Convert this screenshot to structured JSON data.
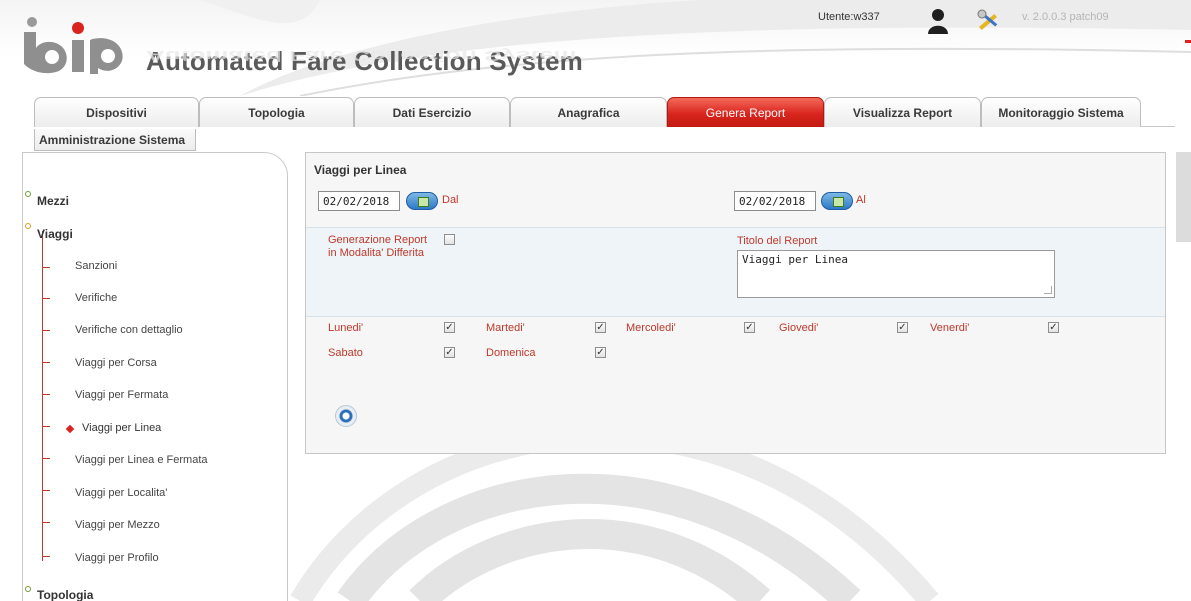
{
  "header": {
    "logo_text": "bip",
    "app_title": "Automated Fare Collection System",
    "user": "Utente:w337",
    "version": "v. 2.0.0.3 patch09",
    "icons": [
      "user-icon",
      "tools-icon"
    ]
  },
  "tabs": [
    {
      "label": "Dispositivi",
      "active": false
    },
    {
      "label": "Topologia",
      "active": false
    },
    {
      "label": "Dati Esercizio",
      "active": false
    },
    {
      "label": "Anagrafica",
      "active": false
    },
    {
      "label": "Genera Report",
      "active": true
    },
    {
      "label": "Visualizza Report",
      "active": false
    },
    {
      "label": "Monitoraggio Sistema",
      "active": false
    }
  ],
  "tab_row2": {
    "label": "Amministrazione Sistema"
  },
  "sidebar": {
    "groups": [
      {
        "label": "Mezzi"
      },
      {
        "label": "Viaggi"
      },
      {
        "label": "Topologia"
      }
    ],
    "items": [
      {
        "label": "Sanzioni"
      },
      {
        "label": "Verifiche"
      },
      {
        "label": "Verifiche con dettaglio"
      },
      {
        "label": "Viaggi per Corsa"
      },
      {
        "label": "Viaggi per Fermata"
      },
      {
        "label": "Viaggi per Linea"
      },
      {
        "label": "Viaggi per Linea e Fermata"
      },
      {
        "label": "Viaggi per Localita'"
      },
      {
        "label": "Viaggi per Mezzo"
      },
      {
        "label": "Viaggi per Profilo"
      }
    ],
    "current_item": "Viaggi per Linea"
  },
  "form": {
    "title": "Viaggi per Linea",
    "date_from": {
      "value": "02/02/2018",
      "label": "Dal"
    },
    "date_to": {
      "value": "02/02/2018",
      "label": "Al"
    },
    "deferred": {
      "label_line1": "Generazione Report",
      "label_line2": "in Modalita' Differita",
      "checked": false
    },
    "report_title": {
      "label": "Titolo del Report",
      "value": "Viaggi per Linea"
    },
    "days": [
      {
        "label": "Lunedi'",
        "checked": true
      },
      {
        "label": "Martedi'",
        "checked": true
      },
      {
        "label": "Mercoledi'",
        "checked": true
      },
      {
        "label": "Giovedi'",
        "checked": true
      },
      {
        "label": "Venerdi'",
        "checked": true
      },
      {
        "label": "Sabato",
        "checked": true
      },
      {
        "label": "Domenica",
        "checked": true
      }
    ],
    "check_mark": "✓",
    "run_icon": "run-report-icon"
  },
  "colors": {
    "accent_red": "#d9251d",
    "label_red": "#c0392b",
    "band_blue": "#eef4f7"
  }
}
